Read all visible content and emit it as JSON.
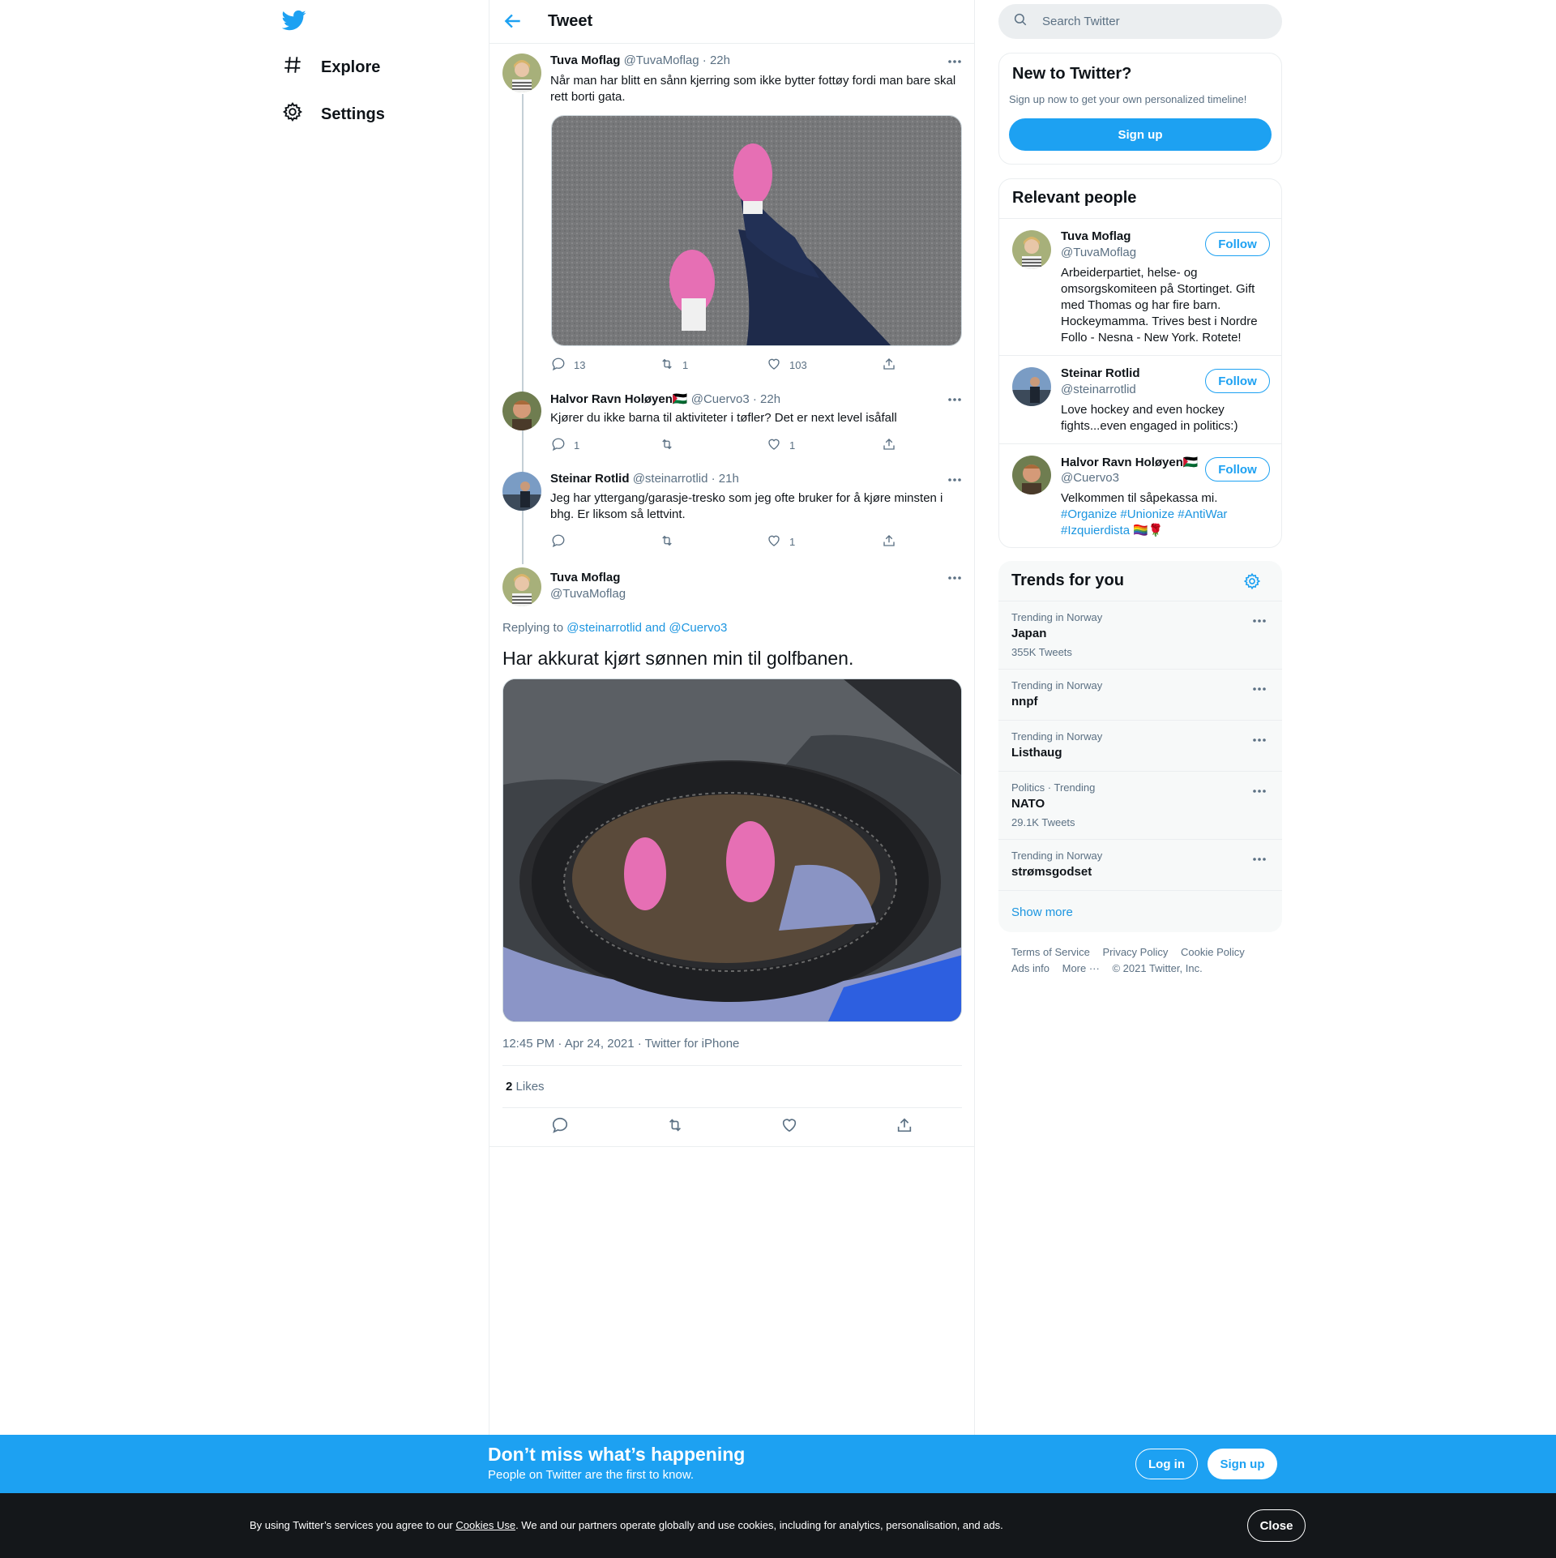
{
  "nav": {
    "explore": "Explore",
    "settings": "Settings"
  },
  "header": {
    "title": "Tweet"
  },
  "thread": [
    {
      "name": "Tuva Moflag",
      "handle": "@TuvaMoflag",
      "time": "22h",
      "text": "Når man har blitt en sånn kjerring som ikke bytter fottøy fordi man bare skal rett borti gata.",
      "replies": "13",
      "retweets": "1",
      "likes": "103"
    },
    {
      "name": "Halvor Ravn Holøyen",
      "flag": "🇵🇸",
      "handle": "@Cuervo3",
      "time": "22h",
      "text": "Kjører du ikke barna til aktiviteter i tøfler? Det er next level isåfall",
      "replies": "1",
      "retweets": "",
      "likes": "1"
    },
    {
      "name": "Steinar Rotlid",
      "handle": "@steinarrotlid",
      "time": "21h",
      "text": "Jeg har yttergang/garasje-tresko som jeg ofte bruker for å kjøre minsten i bhg. Er liksom så lettvint.",
      "replies": "",
      "retweets": "",
      "likes": "1"
    }
  ],
  "main_tweet": {
    "name": "Tuva Moflag",
    "handle": "@TuvaMoflag",
    "replying_prefix": "Replying to",
    "replying_user1": "@steinarrotlid",
    "replying_and": "and",
    "replying_user2": "@Cuervo3",
    "text": "Har akkurat kjørt sønnen min til golfbanen.",
    "timestamp": "12:45 PM · Apr 24, 2021 · Twitter for iPhone",
    "likes_count": "2",
    "likes_label": "Likes"
  },
  "search": {
    "placeholder": "Search Twitter"
  },
  "new_to_twitter": {
    "title": "New to Twitter?",
    "subtitle": "Sign up now to get your own personalized timeline!",
    "button": "Sign up"
  },
  "relevant_people": {
    "title": "Relevant people",
    "people": [
      {
        "name": "Tuva Moflag",
        "handle": "@TuvaMoflag",
        "bio": "Arbeiderpartiet, helse- og omsorgskomiteen på Stortinget. Gift med Thomas og har fire barn. Hockeymamma. Trives best i Nordre Follo - Nesna - New York. Rotete!",
        "follow": "Follow"
      },
      {
        "name": "Steinar Rotlid",
        "handle": "@steinarrotlid",
        "bio": "Love hockey and even hockey fights...even engaged in politics:)",
        "follow": "Follow"
      },
      {
        "name": "Halvor Ravn Holøyen",
        "flag": "🇵🇸",
        "handle": "@Cuervo3",
        "bio_plain": "Velkommen til såpekassa mi.",
        "bio_tags": [
          "#Organize",
          "#Unionize",
          "#AntiWar",
          "#Izquierdista"
        ],
        "bio_tail": "🏳️‍🌈🌹",
        "follow": "Follow"
      }
    ]
  },
  "trends": {
    "title": "Trends for you",
    "items": [
      {
        "meta": "Trending in Norway",
        "name": "Japan",
        "count": "355K Tweets"
      },
      {
        "meta": "Trending in Norway",
        "name": "nnpf",
        "count": ""
      },
      {
        "meta": "Trending in Norway",
        "name": "Listhaug",
        "count": ""
      },
      {
        "meta": "Politics · Trending",
        "name": "NATO",
        "count": "29.1K Tweets"
      },
      {
        "meta": "Trending in Norway",
        "name": "strømsgodset",
        "count": ""
      }
    ],
    "show_more": "Show more"
  },
  "footer": {
    "terms": "Terms of Service",
    "privacy": "Privacy Policy",
    "cookie": "Cookie Policy",
    "ads": "Ads info",
    "more": "More ···",
    "copyright": "© 2021 Twitter, Inc."
  },
  "bottom_bar": {
    "title": "Don’t miss what’s happening",
    "subtitle": "People on Twitter are the first to know.",
    "login": "Log in",
    "signup": "Sign up"
  },
  "cookie_bar": {
    "text_before": "By using Twitter’s services you agree to our",
    "link": "Cookies Use",
    "text_after": ". We and our partners operate globally and use cookies, including for analytics, personalisation, and ads.",
    "close": "Close"
  },
  "colors": {
    "accent": "#1da1f2",
    "link": "#1b95e0",
    "secondary_text": "#5b7083",
    "cookie_bg": "#14171a"
  }
}
